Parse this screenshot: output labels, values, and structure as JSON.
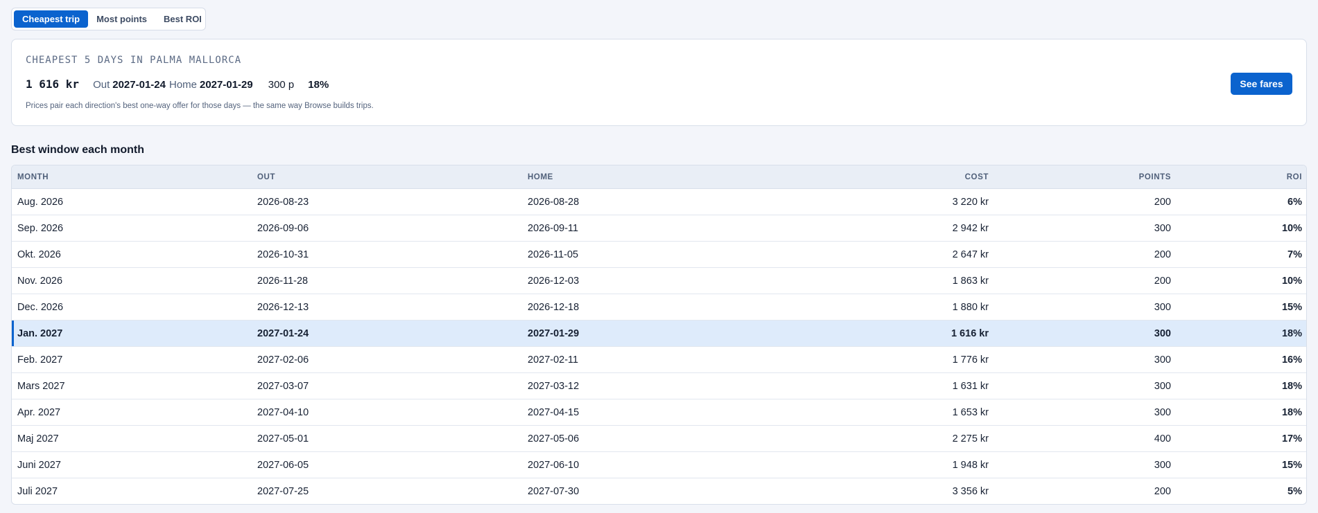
{
  "tabs": [
    {
      "label": "Cheapest trip",
      "active": true
    },
    {
      "label": "Most points",
      "active": false
    },
    {
      "label": "Best ROI",
      "active": false
    }
  ],
  "card": {
    "title": "CHEAPEST 5 DAYS IN PALMA MALLORCA",
    "price": "1 616 kr",
    "out_label": "Out",
    "out_date": "2027-01-24",
    "home_label": "Home",
    "home_date": "2027-01-29",
    "points": "300 p",
    "roi": "18%",
    "note": "Prices pair each direction's best one-way offer for those days — the same way Browse builds trips.",
    "button_label": "See fares"
  },
  "section_title": "Best window each month",
  "table": {
    "headers": {
      "month": "MONTH",
      "out": "OUT",
      "home": "HOME",
      "cost": "COST",
      "points": "POINTS",
      "roi": "ROI"
    },
    "selected_index": 5,
    "rows": [
      {
        "month": "Aug. 2026",
        "out": "2026-08-23",
        "home": "2026-08-28",
        "cost": "3 220 kr",
        "points": "200",
        "roi": "6%"
      },
      {
        "month": "Sep. 2026",
        "out": "2026-09-06",
        "home": "2026-09-11",
        "cost": "2 942 kr",
        "points": "300",
        "roi": "10%"
      },
      {
        "month": "Okt. 2026",
        "out": "2026-10-31",
        "home": "2026-11-05",
        "cost": "2 647 kr",
        "points": "200",
        "roi": "7%"
      },
      {
        "month": "Nov. 2026",
        "out": "2026-11-28",
        "home": "2026-12-03",
        "cost": "1 863 kr",
        "points": "200",
        "roi": "10%"
      },
      {
        "month": "Dec. 2026",
        "out": "2026-12-13",
        "home": "2026-12-18",
        "cost": "1 880 kr",
        "points": "300",
        "roi": "15%"
      },
      {
        "month": "Jan. 2027",
        "out": "2027-01-24",
        "home": "2027-01-29",
        "cost": "1 616 kr",
        "points": "300",
        "roi": "18%"
      },
      {
        "month": "Feb. 2027",
        "out": "2027-02-06",
        "home": "2027-02-11",
        "cost": "1 776 kr",
        "points": "300",
        "roi": "16%"
      },
      {
        "month": "Mars 2027",
        "out": "2027-03-07",
        "home": "2027-03-12",
        "cost": "1 631 kr",
        "points": "300",
        "roi": "18%"
      },
      {
        "month": "Apr. 2027",
        "out": "2027-04-10",
        "home": "2027-04-15",
        "cost": "1 653 kr",
        "points": "300",
        "roi": "18%"
      },
      {
        "month": "Maj 2027",
        "out": "2027-05-01",
        "home": "2027-05-06",
        "cost": "2 275 kr",
        "points": "400",
        "roi": "17%"
      },
      {
        "month": "Juni 2027",
        "out": "2027-06-05",
        "home": "2027-06-10",
        "cost": "1 948 kr",
        "points": "300",
        "roi": "15%"
      },
      {
        "month": "Juli 2027",
        "out": "2027-07-25",
        "home": "2027-07-30",
        "cost": "3 356 kr",
        "points": "200",
        "roi": "5%"
      }
    ]
  },
  "colors": {
    "accent": "#0b63ce",
    "selected_row": "#deebfb",
    "background": "#f3f5fa"
  }
}
